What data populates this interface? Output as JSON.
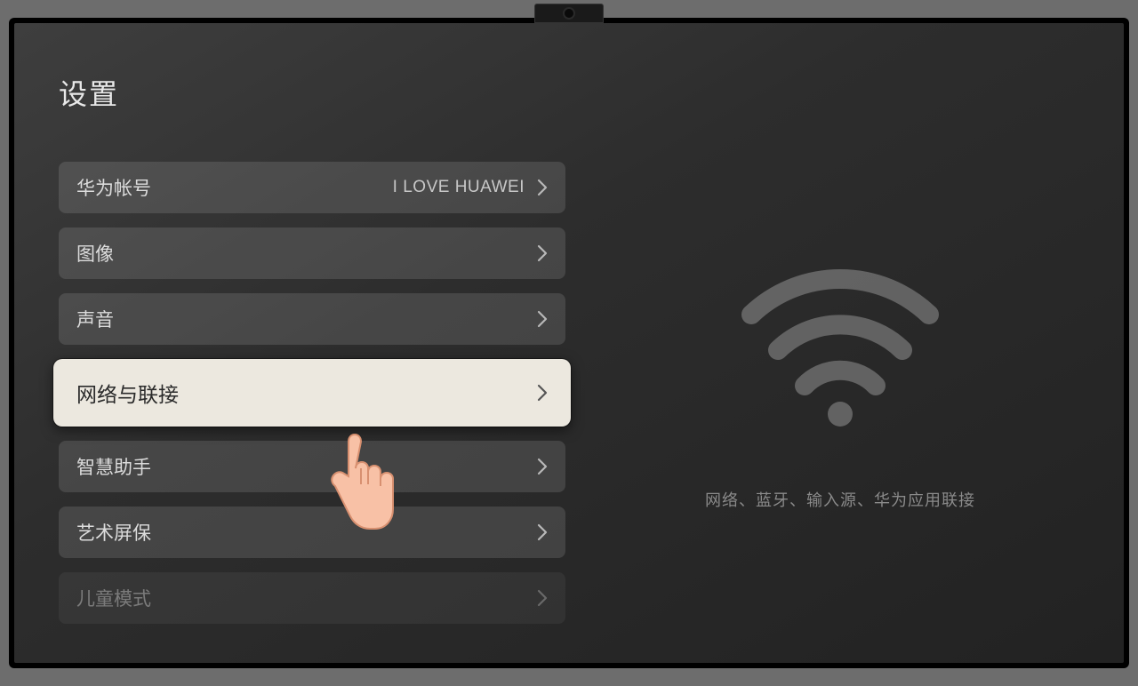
{
  "title": "设置",
  "menu": {
    "account": {
      "label": "华为帐号",
      "value": "I LOVE HUAWEI"
    },
    "image": {
      "label": "图像"
    },
    "sound": {
      "label": "声音"
    },
    "network": {
      "label": "网络与联接"
    },
    "assistant": {
      "label": "智慧助手"
    },
    "screensaver": {
      "label": "艺术屏保"
    },
    "child": {
      "label": "儿童模式"
    }
  },
  "detail": {
    "description": "网络、蓝牙、输入源、华为应用联接"
  }
}
